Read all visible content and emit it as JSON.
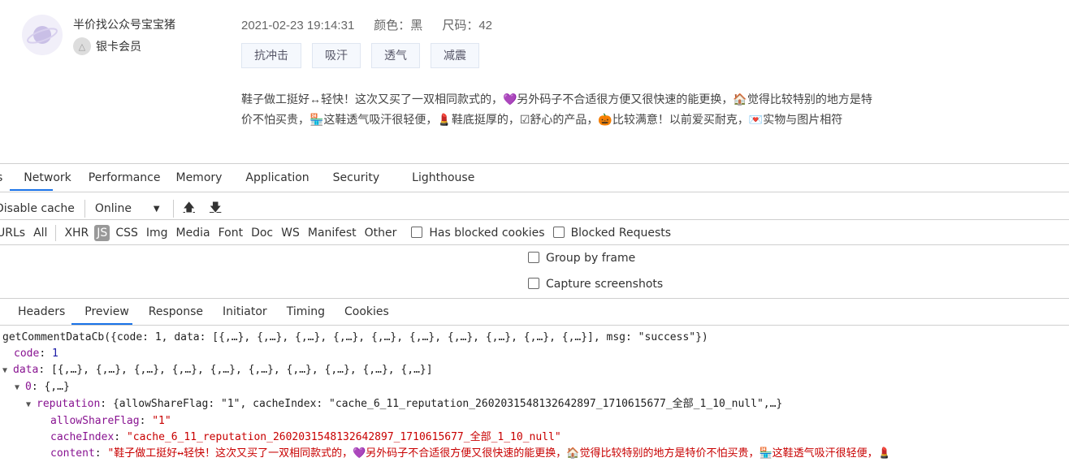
{
  "review": {
    "username": "半价找公众号宝宝猪",
    "member_level": "银卡会员",
    "date": "2021-02-23 19:14:31",
    "color": "颜色：黑",
    "size": "尺码：42",
    "tags": [
      "抗冲击",
      "吸汗",
      "透气",
      "减震"
    ],
    "content": "鞋子做工挺好↔轻快！这次又买了一双相同款式的，💜另外码子不合适很方便又很快速的能更换，🏠觉得比较特别的地方是特价不怕买贵，🏪这鞋透气吸汗很轻便，💄鞋底挺厚的，☑舒心的产品，🎃比较满意！以前爱买耐克，💌实物与图片相符"
  },
  "devtools": {
    "tabs": [
      "s",
      "Network",
      "Performance",
      "Memory",
      "Application",
      "Security",
      "Lighthouse"
    ],
    "active_tab": "Network",
    "toolbar": {
      "disable_cache": "Disable cache",
      "throttle": "Online",
      "upload_icon": "upload-icon",
      "download_icon": "download-icon"
    },
    "filters": [
      "URLs",
      "All",
      "XHR",
      "JS",
      "CSS",
      "Img",
      "Media",
      "Font",
      "Doc",
      "WS",
      "Manifest",
      "Other"
    ],
    "active_filter": "JS",
    "has_blocked_cookies": "Has blocked cookies",
    "blocked_requests": "Blocked Requests",
    "group_by_frame": "Group by frame",
    "capture_screenshots": "Capture screenshots",
    "subtabs": [
      "Headers",
      "Preview",
      "Response",
      "Initiator",
      "Timing",
      "Cookies"
    ],
    "active_subtab": "Preview"
  },
  "preview": {
    "line0": "getCommentDataCb({code: 1, data: [{,…}, {,…}, {,…}, {,…}, {,…}, {,…}, {,…}, {,…}, {,…}, {,…}], msg: \"success\"})",
    "code_key": "code",
    "code_val": "1",
    "data_key": "data",
    "data_val": "[{,…}, {,…}, {,…}, {,…}, {,…}, {,…}, {,…}, {,…}, {,…}, {,…}]",
    "item_key": "0",
    "item_val": "{,…}",
    "rep_key": "reputation",
    "rep_val": "{allowShareFlag: \"1\", cacheIndex: \"cache_6_11_reputation_2602031548132642897_1710615677_全部_1_10_null\",…}",
    "asf_key": "allowShareFlag",
    "asf_val": "\"1\"",
    "ci_key": "cacheIndex",
    "ci_val": "\"cache_6_11_reputation_2602031548132642897_1710615677_全部_1_10_null\"",
    "content_key": "content",
    "content_val": "\"鞋子做工挺好↔轻快！这次又买了一双相同款式的，💜另外码子不合适很方便又很快速的能更换，🏠觉得比较特别的地方是特价不怕买贵，🏪这鞋透气吸汗很轻便，💄"
  },
  "colors": {
    "accent": "#1a73e8",
    "key": "#881391",
    "string": "#c80000",
    "number": "#1a1aa6"
  }
}
